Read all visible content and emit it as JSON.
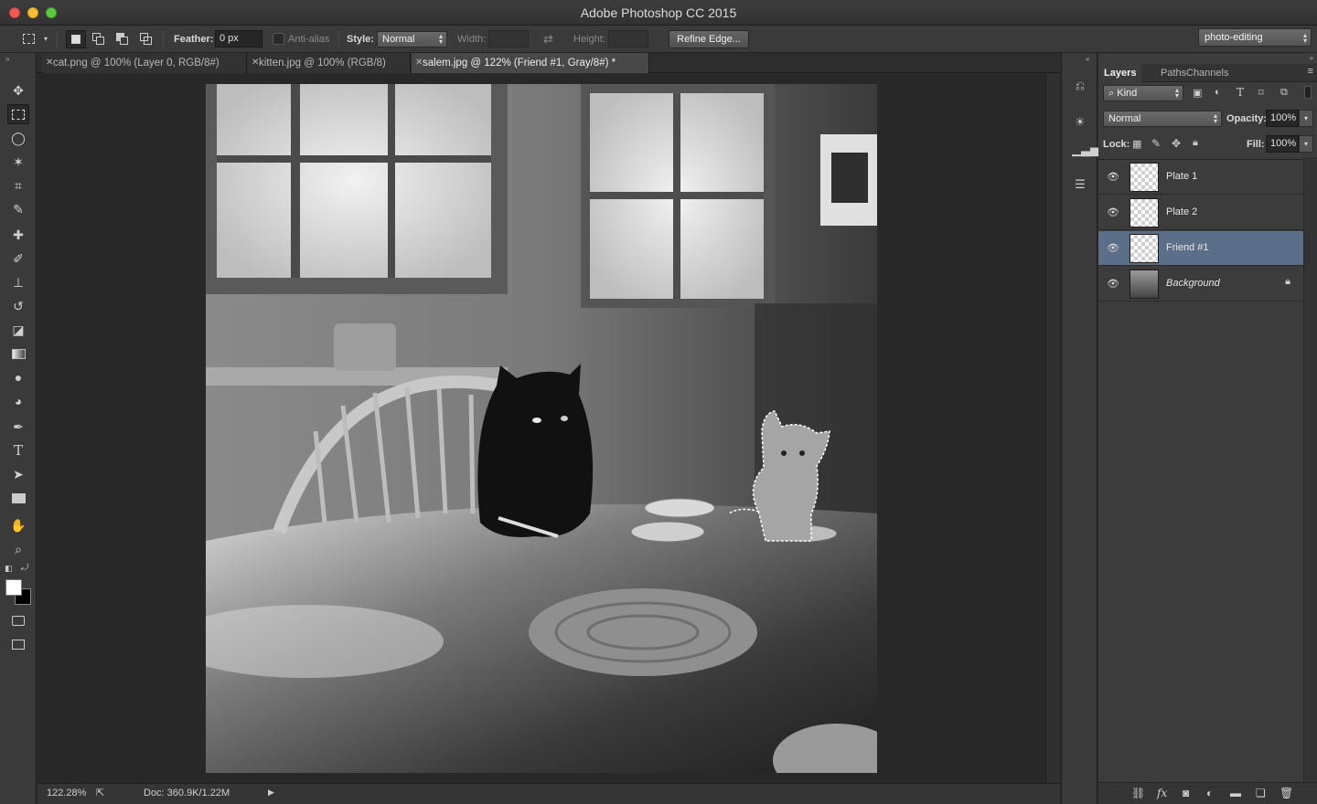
{
  "window": {
    "title": "Adobe Photoshop CC 2015"
  },
  "options_bar": {
    "feather_label": "Feather:",
    "feather_value": "0 px",
    "anti_alias_label": "Anti-alias",
    "style_label": "Style:",
    "style_value": "Normal",
    "width_label": "Width:",
    "height_label": "Height:",
    "refine_edge_label": "Refine Edge...",
    "workspace_value": "photo-editing"
  },
  "tabs": [
    {
      "label": "cat.png @ 100% (Layer 0, RGB/8#)"
    },
    {
      "label": "kitten.jpg @ 100% (RGB/8)"
    },
    {
      "label": "salem.jpg @ 122% (Friend #1, Gray/8#) *"
    }
  ],
  "active_tab_index": 2,
  "status_bar": {
    "zoom": "122.28%",
    "doc_info": "Doc: 360.9K/1.22M"
  },
  "layers_panel": {
    "tabs": [
      "Layers",
      "Paths",
      "Channels"
    ],
    "filter_label": "Kind",
    "blend_mode": "Normal",
    "opacity_label": "Opacity:",
    "opacity_value": "100%",
    "lock_label": "Lock:",
    "fill_label": "Fill:",
    "fill_value": "100%",
    "layers": [
      {
        "name": "Plate 1",
        "selected": false,
        "locked": false
      },
      {
        "name": "Plate 2",
        "selected": false,
        "locked": false
      },
      {
        "name": "Friend #1",
        "selected": true,
        "locked": false
      },
      {
        "name": "Background",
        "selected": false,
        "locked": true
      }
    ]
  },
  "tools": [
    "move-tool-icon",
    "rectangular-marquee-tool-icon",
    "lasso-tool-icon",
    "magic-wand-tool-icon",
    "crop-tool-icon",
    "eyedropper-tool-icon",
    "healing-brush-tool-icon",
    "brush-tool-icon",
    "clone-stamp-tool-icon",
    "history-brush-tool-icon",
    "eraser-tool-icon",
    "gradient-tool-icon",
    "blur-tool-icon",
    "dodge-tool-icon",
    "pen-tool-icon",
    "type-tool-icon",
    "path-selection-tool-icon",
    "rectangle-tool-icon",
    "hand-tool-icon",
    "zoom-tool-icon"
  ],
  "colors": {
    "foreground": "#ffffff",
    "background": "#000000",
    "selection_highlight": "#5c6f8a"
  }
}
